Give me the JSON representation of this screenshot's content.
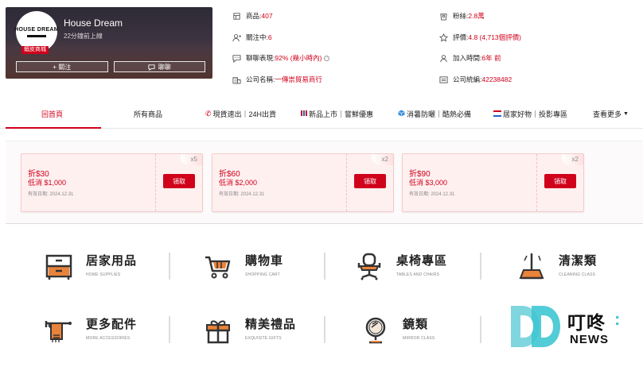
{
  "shop": {
    "logo_text": "HOUSE DREAM",
    "name": "House Dream",
    "online": "22分鐘前上線",
    "mall_badge": "蝦皮商城",
    "follow_label": "+  關注",
    "chat_label": "聊聊"
  },
  "stats": {
    "products_label": "商品: ",
    "products_value": "407",
    "following_label": "關注中: ",
    "following_value": "6",
    "chat_label": "聊聊表現: ",
    "chat_value": "92% (幾小時內)",
    "company_label": "公司名稱: ",
    "company_value": "一傳崇貿易商行",
    "fans_label": "粉絲: ",
    "fans_value": "2.8萬",
    "rating_label": "評價: ",
    "rating_value": "4.8 (4,713個評價)",
    "joined_label": "加入時間: ",
    "joined_value": "6年 前",
    "taxid_label": "公司統編: ",
    "taxid_value": "42238482"
  },
  "nav": {
    "items": [
      "回首頁",
      "所有商品",
      "現貨速出｜24H出貨",
      "新品上市｜嘗鮮優惠",
      "消暑防曬｜酷熱必備",
      "居家好物｜投影專區",
      "查看更多"
    ]
  },
  "vouchers": [
    {
      "discount": "折$30",
      "min": "低消 $1,000",
      "expiry": "有效日期: 2024.12.31",
      "claim": "領取",
      "count": "x5"
    },
    {
      "discount": "折$60",
      "min": "低消 $2,000",
      "expiry": "有效日期: 2024.12.31",
      "claim": "領取",
      "count": "x2"
    },
    {
      "discount": "折$90",
      "min": "低消 $3,000",
      "expiry": "有效日期: 2024.12.31",
      "claim": "領取",
      "count": "x2"
    }
  ],
  "categories": [
    {
      "title": "居家用品",
      "subtitle": "HOME SUPPLIES",
      "icon": "drawer-cabinet-icon"
    },
    {
      "title": "購物車",
      "subtitle": "SHOPPING CART",
      "icon": "shopping-cart-icon"
    },
    {
      "title": "桌椅專區",
      "subtitle": "TABLES AND CHAIRS",
      "icon": "office-chair-icon"
    },
    {
      "title": "清潔類",
      "subtitle": "CLEANING CLASS",
      "icon": "mop-icon"
    },
    {
      "title": "更多配件",
      "subtitle": "MORE ACCESSORIES",
      "icon": "towel-rack-icon"
    },
    {
      "title": "精美禮品",
      "subtitle": "EXQUISITE GIFTS",
      "icon": "gift-box-icon"
    },
    {
      "title": "鏡類",
      "subtitle": "MIRROR CLASS",
      "icon": "mirror-icon"
    }
  ],
  "watermark": {
    "title": "叮咚",
    "colon": ":",
    "sub": "NEWS"
  },
  "colors": {
    "accent": "#d0011b",
    "watermark_teal": "#3fc6d3"
  }
}
